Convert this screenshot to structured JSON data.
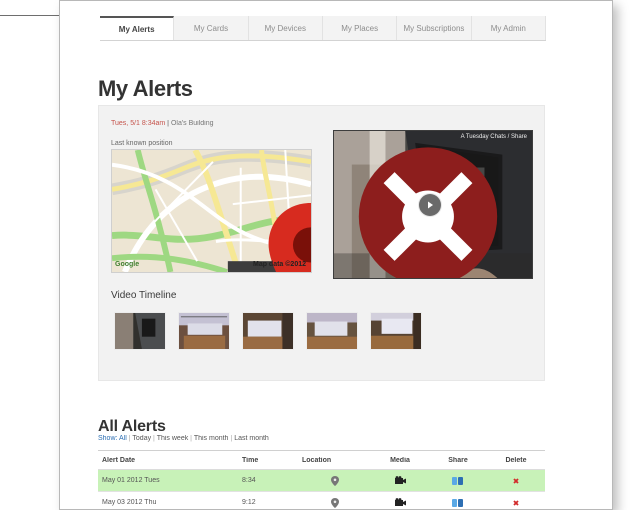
{
  "tabs": [
    {
      "label": "My Alerts",
      "active": true
    },
    {
      "label": "My Cards",
      "active": false
    },
    {
      "label": "My Devices",
      "active": false
    },
    {
      "label": "My Places",
      "active": false
    },
    {
      "label": "My Subscriptions",
      "active": false
    },
    {
      "label": "My Admin",
      "active": false
    }
  ],
  "page": {
    "title": "My Alerts"
  },
  "latest_alert": {
    "time_text": "Tues, 5/1 8:34am",
    "separator": " | ",
    "location_text": "Ola's Building",
    "map_caption": "Last known position",
    "map_brand": "Google",
    "map_scale": "Map data ©2012",
    "video_overlay": "A Tuesday Chats / Share",
    "timeline_label": "Video Timeline",
    "timeline_count": 5
  },
  "all_alerts": {
    "title": "All Alerts",
    "filters": [
      "Show: All",
      "Today",
      "This week",
      "This month",
      "Last month"
    ],
    "active_filter_index": 0,
    "columns": [
      "Alert Date",
      "Time",
      "Location",
      "Media",
      "Share",
      "Delete"
    ],
    "rows": [
      {
        "date": "May 01 2012 Tues",
        "time": "8:34",
        "location_icon": "location-icon",
        "media_icon": "video-icon",
        "share_icon": "share-icon",
        "delete_icon": "delete-icon",
        "highlight": true
      },
      {
        "date": "May 03 2012 Thu",
        "time": "9:12",
        "location_icon": "location-icon",
        "media_icon": "video-icon",
        "share_icon": "share-icon",
        "delete_icon": "delete-icon",
        "highlight": false
      }
    ]
  },
  "colors": {
    "accent": "#2d6fb3",
    "alert_red": "#c5544c",
    "row_highlight": "#c8f2b8"
  }
}
